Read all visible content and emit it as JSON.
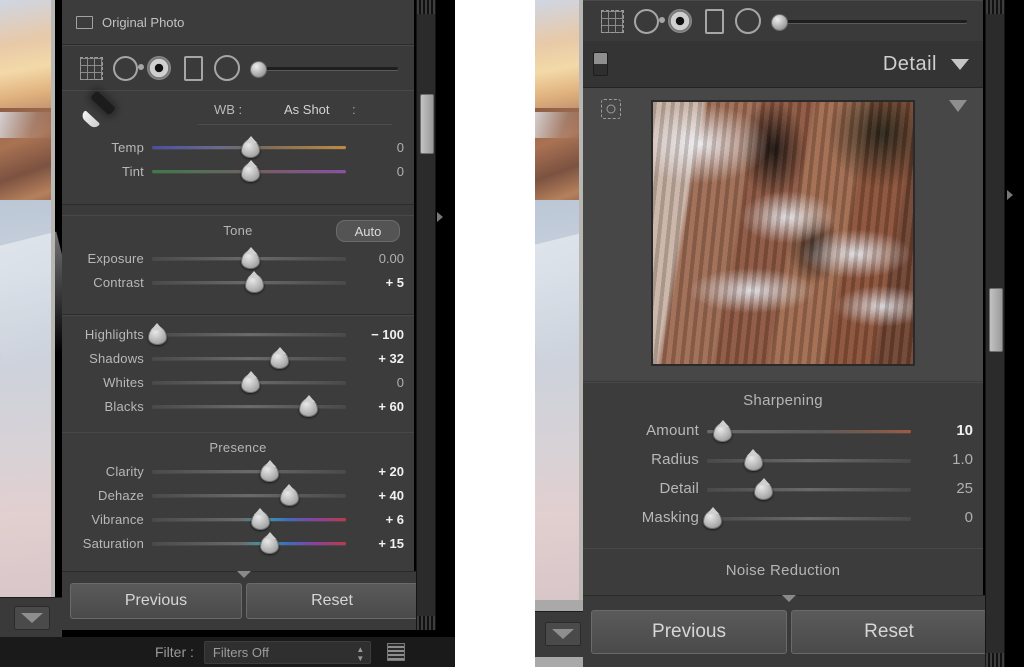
{
  "app": "Adobe Photoshop Lightroom — Develop module panels",
  "left_panel": {
    "original_photo": {
      "label": "Original Photo",
      "icon": "rectangle-icon"
    },
    "tools": [
      {
        "name": "crop-overlay-tool",
        "icon": "crop-grid-icon"
      },
      {
        "name": "spot-removal-tool",
        "icon": "spot-circle-icon"
      },
      {
        "name": "red-eye-tool",
        "icon": "eye-circle-icon"
      },
      {
        "name": "graduated-filter-tool",
        "icon": "rectangle-filter-icon"
      },
      {
        "name": "radial-filter-tool",
        "icon": "circle-filter-icon"
      }
    ],
    "tool_slider": {
      "name": "tool-size-slider",
      "position_pct": 2
    },
    "wb": {
      "eyedropper": "eyedropper-icon",
      "label": "WB :",
      "value": "As Shot",
      "caret": ":",
      "sliders": [
        {
          "label": "Temp",
          "value": "0",
          "pos_pct": 50,
          "gradient": "temp",
          "modified": false
        },
        {
          "label": "Tint",
          "value": "0",
          "pos_pct": 50,
          "gradient": "tint",
          "modified": false
        }
      ]
    },
    "tone": {
      "title": "Tone",
      "auto_label": "Auto",
      "sliders": [
        {
          "label": "Exposure",
          "value": "0.00",
          "pos_pct": 50,
          "gradient": "plain",
          "modified": false
        },
        {
          "label": "Contrast",
          "value": "+ 5",
          "pos_pct": 52,
          "gradient": "plain",
          "modified": false
        }
      ]
    },
    "tone_detail": {
      "sliders": [
        {
          "label": "Highlights",
          "value": "− 100",
          "pos_pct": 2,
          "gradient": "plain",
          "modified": true
        },
        {
          "label": "Shadows",
          "value": "+ 32",
          "pos_pct": 65,
          "gradient": "plain",
          "modified": true
        },
        {
          "label": "Whites",
          "value": "0",
          "pos_pct": 50,
          "gradient": "plain",
          "modified": false
        },
        {
          "label": "Blacks",
          "value": "+ 60",
          "pos_pct": 80,
          "gradient": "plain",
          "modified": true
        }
      ]
    },
    "presence": {
      "title": "Presence",
      "sliders": [
        {
          "label": "Clarity",
          "value": "+ 20",
          "pos_pct": 60,
          "gradient": "plain",
          "modified": true
        },
        {
          "label": "Dehaze",
          "value": "+ 40",
          "pos_pct": 70,
          "gradient": "plain",
          "modified": true
        },
        {
          "label": "Vibrance",
          "value": "+ 6",
          "pos_pct": 55,
          "gradient": "vib",
          "modified": true
        },
        {
          "label": "Saturation",
          "value": "+ 15",
          "pos_pct": 60,
          "gradient": "vib",
          "modified": true
        }
      ]
    },
    "buttons": {
      "previous": "Previous",
      "reset": "Reset"
    },
    "filter_bar": {
      "label": "Filter :",
      "value": "Filters Off",
      "icon": "filter-list-icon"
    }
  },
  "right_panel": {
    "tools": [
      {
        "name": "crop-overlay-tool",
        "icon": "crop-grid-icon"
      },
      {
        "name": "spot-removal-tool",
        "icon": "spot-circle-icon"
      },
      {
        "name": "red-eye-tool",
        "icon": "eye-circle-icon"
      },
      {
        "name": "graduated-filter-tool",
        "icon": "rectangle-filter-icon"
      },
      {
        "name": "radial-filter-tool",
        "icon": "circle-filter-icon"
      }
    ],
    "tool_slider": {
      "name": "tool-size-slider",
      "position_pct": 2
    },
    "header": {
      "title": "Detail",
      "toggle": "panel-switch",
      "disclosure": "triangle-down-icon"
    },
    "preview": {
      "loupe_icon": "loupe-target-icon",
      "triangle_icon": "triangle-down-icon",
      "alt": "Snow covered Bryce Canyon hoodoos detail preview"
    },
    "sharpening": {
      "title": "Sharpening",
      "sliders": [
        {
          "label": "Amount",
          "value": "10",
          "pos_pct": 7,
          "gradient": "amt",
          "modified": true
        },
        {
          "label": "Radius",
          "value": "1.0",
          "pos_pct": 22,
          "gradient": "plain",
          "modified": false
        },
        {
          "label": "Detail",
          "value": "25",
          "pos_pct": 27,
          "gradient": "plain",
          "modified": false
        },
        {
          "label": "Masking",
          "value": "0",
          "pos_pct": 2,
          "gradient": "plain",
          "modified": false
        }
      ]
    },
    "noise_reduction": {
      "title": "Noise Reduction"
    },
    "buttons": {
      "previous": "Previous",
      "reset": "Reset"
    }
  },
  "colors": {
    "panel_bg": "#3a3a3a",
    "section_bg": "#3c3c3c",
    "text": "#b8b8b8",
    "text_hot": "#f0f0f0",
    "window_bg": "#000000"
  }
}
